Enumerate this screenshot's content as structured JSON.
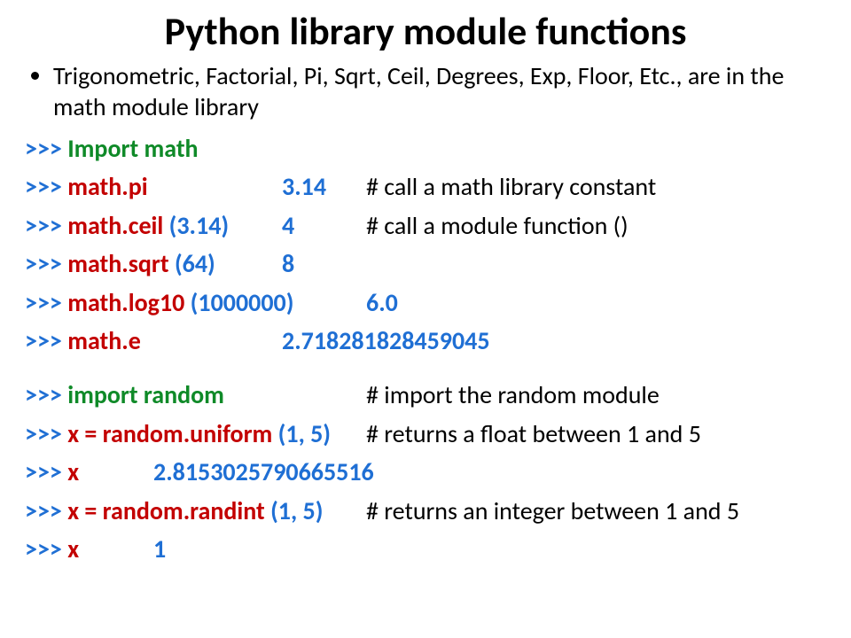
{
  "title": "Python library module functions",
  "bullet": "Trigonometric, Factorial, Pi, Sqrt, Ceil, Degrees, Exp, Floor, Etc., are in the math module library",
  "prompt": ">>>",
  "lines": {
    "l1": {
      "code": "Import math"
    },
    "l2": {
      "code": "math.pi",
      "arg": "",
      "result": "3.14",
      "comment": "# call a math library constant"
    },
    "l3": {
      "code": "math.ceil ",
      "arg": "(3.14)",
      "result": "4",
      "comment": "# call a module function ()"
    },
    "l4": {
      "code": "math.sqrt ",
      "arg": "(64)",
      "result": "8"
    },
    "l5": {
      "code": "math.log10 ",
      "arg": "(1000000)",
      "result": "6.0"
    },
    "l6": {
      "code": "math.e",
      "result": "2.718281828459045"
    },
    "l7": {
      "code": "import random",
      "comment": "# import the random module"
    },
    "l8": {
      "code": "x = random.uniform ",
      "arg": "(1, 5)",
      "comment": "# returns a float between 1 and 5"
    },
    "l9": {
      "code": "x",
      "result": "2.8153025790665516"
    },
    "l10": {
      "code": "x = random.randint ",
      "arg": "(1, 5)",
      "comment": "# returns an integer between 1 and 5"
    },
    "l11": {
      "code": "x",
      "result": "1"
    }
  }
}
